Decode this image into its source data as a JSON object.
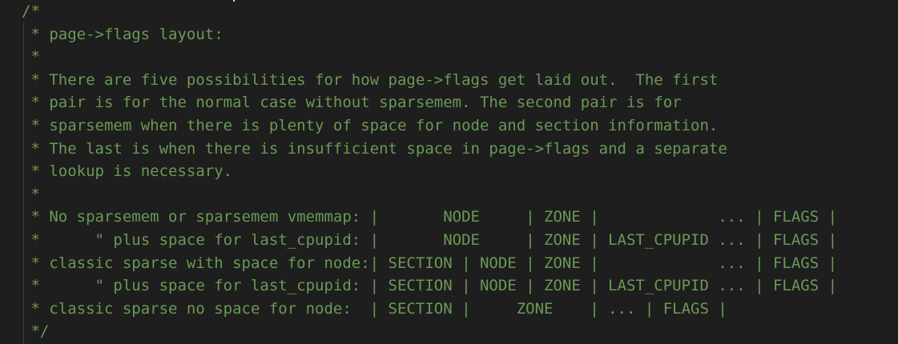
{
  "editor": {
    "comment_lines": [
      "/*",
      " * page->flags layout:",
      " *",
      " * There are five possibilities for how page->flags get laid out.  The first",
      " * pair is for the normal case without sparsemem. The second pair is for",
      " * sparsemem when there is plenty of space for node and section information.",
      " * The last is when there is insufficient space in page->flags and a separate",
      " * lookup is necessary.",
      " *",
      " * No sparsemem or sparsemem vmemmap: |       NODE     | ZONE |             ... | FLAGS |",
      " *      \" plus space for last_cpupid: |       NODE     | ZONE | LAST_CPUPID ... | FLAGS |",
      " * classic sparse with space for node:| SECTION | NODE | ZONE |             ... | FLAGS |",
      " *      \" plus space for last_cpupid: | SECTION | NODE | ZONE | LAST_CPUPID ... | FLAGS |",
      " * classic sparse no space for node:  | SECTION |     ZONE    | ... | FLAGS |",
      " */"
    ],
    "colors": {
      "background": "#1e1e1e",
      "comment": "#6a9955",
      "indent_guide": "#404040"
    }
  }
}
